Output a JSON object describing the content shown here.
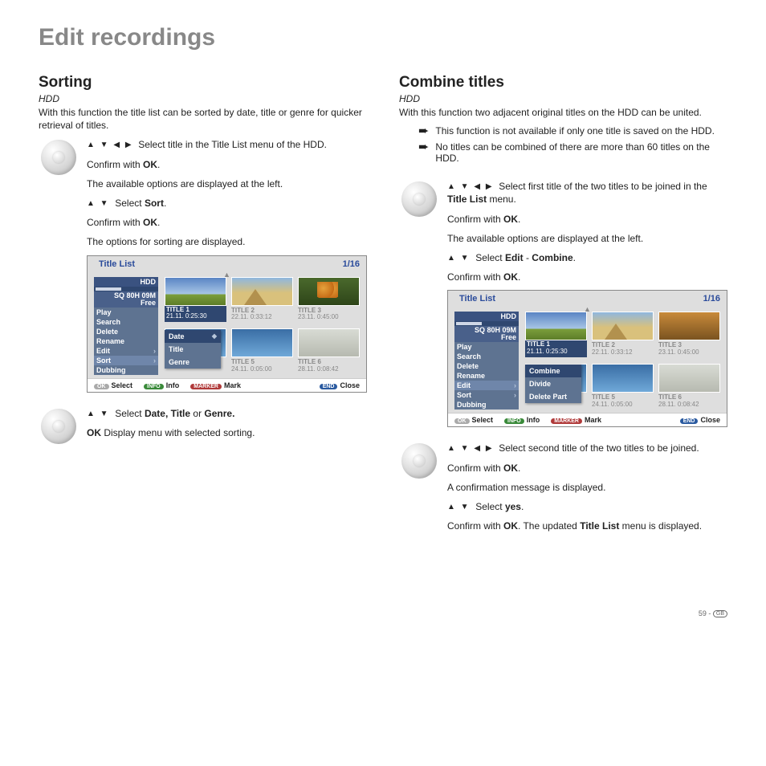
{
  "page_title": "Edit recordings",
  "left": {
    "heading": "Sorting",
    "sub": "HDD",
    "intro": "With this function the title list can be sorted by date, title or genre for quicker retrieval of titles.",
    "step1": "Select title in the Title List menu of the HDD.",
    "step2a": "Confirm with ",
    "step2b": "OK",
    "step2c": ".",
    "step3": "The available options are displayed at the left.",
    "step4a": "Select ",
    "step4b": "Sort",
    "step4c": ".",
    "step5a": "Confirm with ",
    "step5b": "OK",
    "step5c": ".",
    "step6": "The options for sorting are displayed.",
    "step7a": "Select ",
    "step7b": "Date, Title",
    "step7c": " or ",
    "step7d": "Genre.",
    "step8a": "OK",
    "step8b": " Display menu with selected sorting.",
    "osd": {
      "title": "Title List",
      "page": "1/16",
      "hdd": "HDD",
      "free1": "SQ 80H 09M",
      "free2": "Free",
      "menu": [
        "Play",
        "Search",
        "Delete",
        "Rename",
        "Edit",
        "Sort",
        "Dubbing"
      ],
      "submenu": [
        "Date",
        "Title",
        "Genre"
      ],
      "thumbs": [
        {
          "name": "TITLE 1",
          "meta": "21.11.  0:25:30",
          "hl": true
        },
        {
          "name": "TITLE 2",
          "meta": "22.11.  0:33:12"
        },
        {
          "name": "TITLE 3",
          "meta": "23.11.  0:45:00"
        },
        {
          "name": "",
          "meta": ""
        },
        {
          "name": "TITLE 5",
          "meta": "24.11.  0:05:00"
        },
        {
          "name": "TITLE 6",
          "meta": "28.11.  0:08:42"
        }
      ],
      "footer": {
        "select": "Select",
        "info": "Info",
        "mark": "Mark",
        "close": "Close",
        "ok": "OK",
        "infob": "INFO",
        "markerb": "MARKER",
        "endb": "END"
      }
    }
  },
  "right": {
    "heading": "Combine titles",
    "sub": "HDD",
    "intro": "With this function two adjacent original titles on the HDD can be united.",
    "bullet1": "This function is not available if only one title is saved on the HDD.",
    "bullet2": "No titles can be combined of there are more than 60 titles on the HDD.",
    "step1a": "Select first title of the two titles to be joined in the ",
    "step1b": "Title List",
    "step1c": " menu.",
    "step2a": "Confirm with ",
    "step2b": "OK",
    "step2c": ".",
    "step3": "The available options are displayed at the left.",
    "step4a": "Select ",
    "step4b": "Edit",
    "step4c": " - ",
    "step4d": "Combine",
    "step4e": ".",
    "step5a": "Confirm with ",
    "step5b": "OK",
    "step5c": ".",
    "osd": {
      "title": "Title List",
      "page": "1/16",
      "hdd": "HDD",
      "free1": "SQ 80H 09M",
      "free2": "Free",
      "menu": [
        "Play",
        "Search",
        "Delete",
        "Rename",
        "Edit",
        "Sort",
        "Dubbing"
      ],
      "submenu": [
        "Combine",
        "Divide",
        "Delete Part"
      ],
      "thumbs": [
        {
          "name": "TITLE 1",
          "meta": "21.11.  0:25:30",
          "hl": true
        },
        {
          "name": "TITLE 2",
          "meta": "22.11.  0:33:12"
        },
        {
          "name": "TITLE 3",
          "meta": "23.11.  0:45:00"
        },
        {
          "name": "",
          "meta": ""
        },
        {
          "name": "TITLE 5",
          "meta": "24.11.  0:05:00"
        },
        {
          "name": "TITLE 6",
          "meta": "28.11.  0:08:42"
        }
      ],
      "footer": {
        "select": "Select",
        "info": "Info",
        "mark": "Mark",
        "close": "Close",
        "ok": "OK",
        "infob": "INFO",
        "markerb": "MARKER",
        "endb": "END"
      }
    },
    "step6": "Select second title of the two titles to be joined.",
    "step7a": "Confirm with ",
    "step7b": "OK",
    "step7c": ".",
    "step8": "A confirmation message is displayed.",
    "step9a": "Select ",
    "step9b": "yes",
    "step9c": ".",
    "step10a": "Confirm with ",
    "step10b": "OK",
    "step10c": ". The updated ",
    "step10d": "Title List",
    "step10e": " menu is displayed."
  },
  "footer": {
    "page": "59 - ",
    "region": "GB"
  }
}
